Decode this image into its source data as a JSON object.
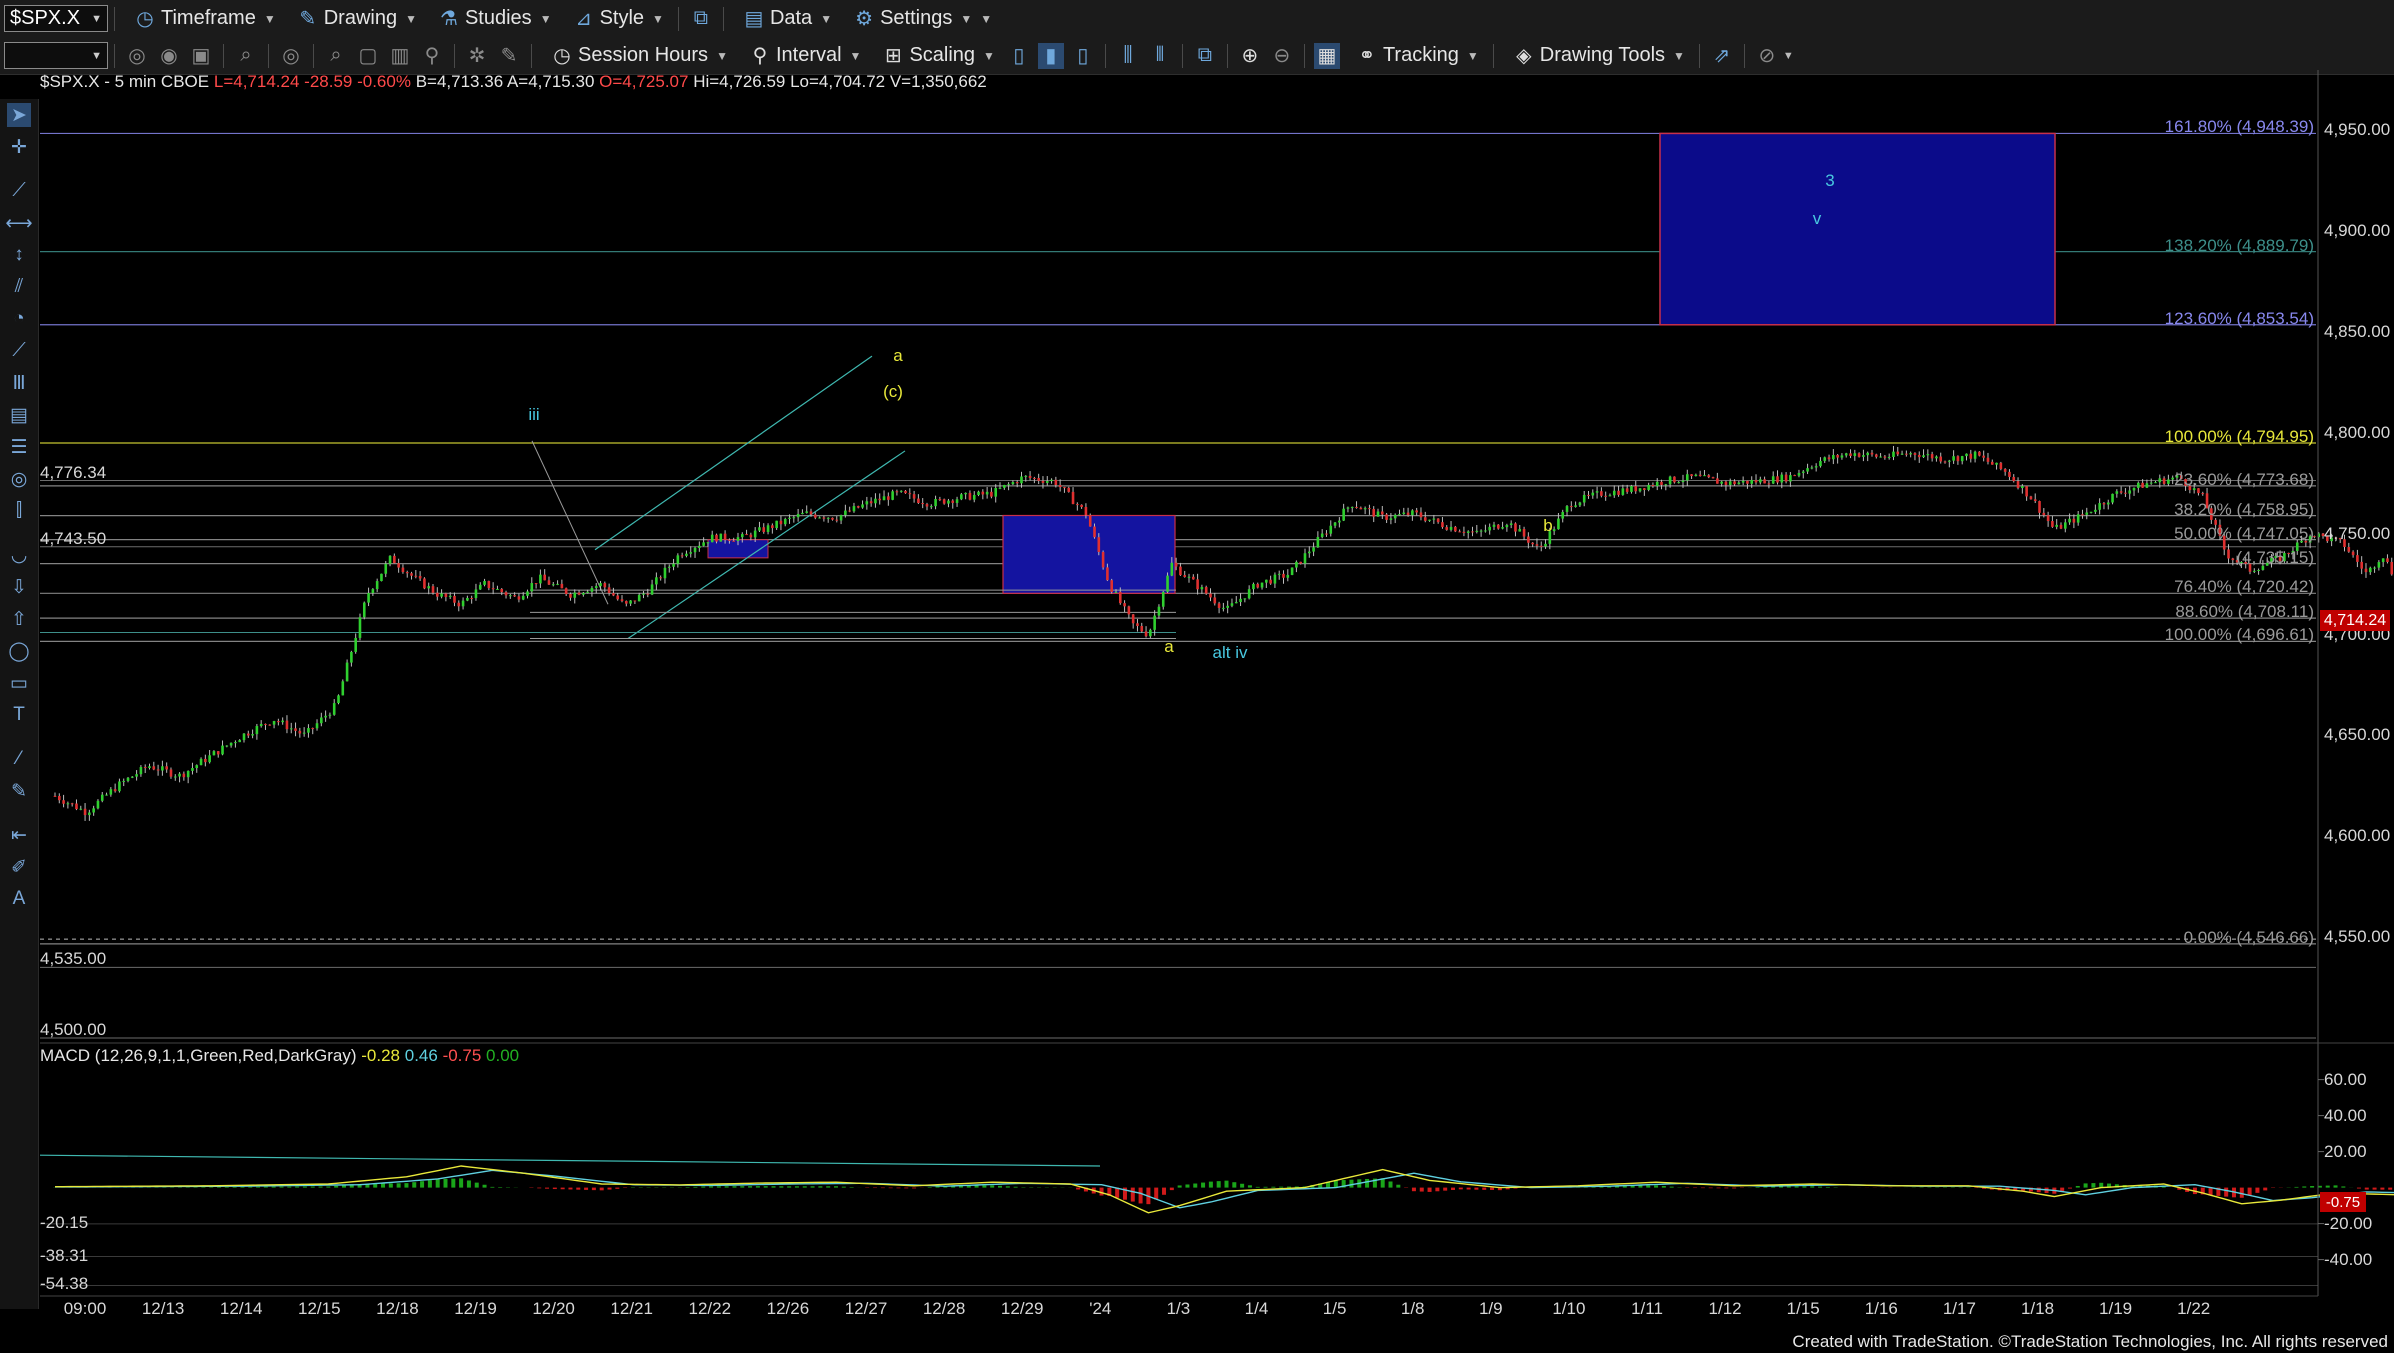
{
  "toolbar1": {
    "symbol": "$SPX.X",
    "items": [
      {
        "label": "Timeframe"
      },
      {
        "label": "Drawing"
      },
      {
        "label": "Studies"
      },
      {
        "label": "Style"
      },
      {
        "label": "Data"
      },
      {
        "label": "Settings"
      }
    ]
  },
  "toolbar2": {
    "items": [
      {
        "label": "Session Hours"
      },
      {
        "label": "Interval"
      },
      {
        "label": "Scaling"
      },
      {
        "label": "Tracking"
      },
      {
        "label": "Drawing Tools"
      }
    ]
  },
  "chart_info": {
    "symbol": "$SPX.X - 5 min  CBOE",
    "last": "L=4,714.24",
    "change": "-28.59",
    "change_pct": "-0.60%",
    "bid": "B=4,713.36",
    "ask": "A=4,715.30",
    "open": "O=4,725.07",
    "high": "Hi=4,726.59",
    "low": "Lo=4,704.72",
    "volume": "V=1,350,662"
  },
  "macd_info": {
    "label": "MACD (12,26,9,1,1,Green,Red,DarkGray)",
    "v1": "-0.28",
    "v2": "0.46",
    "v3": "-0.75",
    "v4": "0.00",
    "c1": "#e8e83a",
    "c2": "#5fd0e0",
    "c3": "#ff5050",
    "c4": "#22b022"
  },
  "chart_data": {
    "type": "candlestick",
    "y_axis_labels": [
      "4,950.00",
      "4,900.00",
      "4,850.00",
      "4,800.00",
      "4,750.00",
      "4,700.00",
      "4,650.00",
      "4,600.00",
      "4,550.00"
    ],
    "ylim": [
      4500,
      4960
    ],
    "macd_axis_labels": [
      "60.00",
      "40.00",
      "20.00",
      "-20.00",
      "-40.00"
    ],
    "macd_ylim": [
      -58,
      72
    ],
    "x_labels": [
      "09:00",
      "12/13",
      "12/14",
      "12/15",
      "12/18",
      "12/19",
      "12/20",
      "12/21",
      "12/22",
      "12/26",
      "12/27",
      "12/28",
      "12/29",
      "'24",
      "1/3",
      "1/4",
      "1/5",
      "1/8",
      "1/9",
      "1/10",
      "1/11",
      "1/12",
      "1/15",
      "1/16",
      "1/17",
      "1/18",
      "1/19",
      "1/22"
    ],
    "last_price_tag": "4,714.24",
    "macd_tag": "-0.75",
    "fib_levels": [
      {
        "label": "161.80% (4,948.39)",
        "value": 4948.39,
        "color": "#8888ee"
      },
      {
        "label": "138.20% (4,889.79)",
        "value": 4889.79,
        "color": "#3d8f8a"
      },
      {
        "label": "123.60% (4,853.54)",
        "value": 4853.54,
        "color": "#8888ee"
      },
      {
        "label": "100.00% (4,794.95)",
        "value": 4794.95,
        "color": "#e8e83a"
      },
      {
        "label": "23.60% (4,773.68)",
        "value": 4773.68,
        "color": "#9a9a9a"
      },
      {
        "label": "38.20% (4,758.95)",
        "value": 4758.95,
        "color": "#9a9a9a"
      },
      {
        "label": "50.00% (4,747.05)",
        "value": 4747.05,
        "color": "#9a9a9a"
      },
      {
        "label": "(4,735.15)",
        "value": 4735.15,
        "color": "#9a9a9a"
      },
      {
        "label": "76.40% (4,720.42)",
        "value": 4720.42,
        "color": "#9a9a9a"
      },
      {
        "label": "88.60% (4,708.11)",
        "value": 4708.11,
        "color": "#9a9a9a"
      },
      {
        "label": "100.00% (4,696.61)",
        "value": 4696.61,
        "color": "#9a9a9a"
      },
      {
        "label": "0.00% (4,546.66)",
        "value": 4546.66,
        "color": "#9a9a9a"
      }
    ],
    "price_levels": [
      {
        "label": "4,776.34",
        "value": 4776.34
      },
      {
        "label": "4,743.50",
        "value": 4743.5
      },
      {
        "label": "4,535.00",
        "value": 4535.0
      },
      {
        "label": "4,500.00",
        "value": 4500.0
      }
    ],
    "macd_levels": [
      {
        "label": "-20.15",
        "value": -20.15
      },
      {
        "label": "-38.31",
        "value": -38.31
      },
      {
        "label": "-54.38",
        "value": -54.38
      }
    ],
    "wave_labels": [
      {
        "text": "iii",
        "color": "#48c8e0"
      },
      {
        "text": "a",
        "color": "#e8e83a"
      },
      {
        "text": "(c)",
        "color": "#e8e83a"
      },
      {
        "text": "b",
        "color": "#e8e83a"
      },
      {
        "text": "a",
        "color": "#e8e83a"
      },
      {
        "text": "alt iv",
        "color": "#48c8e0"
      },
      {
        "text": "3",
        "color": "#48c8e0"
      },
      {
        "text": "v",
        "color": "#48c8e0"
      }
    ],
    "price_path": [
      [
        0.0,
        4620
      ],
      [
        0.4,
        4612
      ],
      [
        0.8,
        4625
      ],
      [
        1.2,
        4635
      ],
      [
        1.6,
        4630
      ],
      [
        2.0,
        4640
      ],
      [
        2.4,
        4650
      ],
      [
        2.8,
        4658
      ],
      [
        3.2,
        4650
      ],
      [
        3.6,
        4665
      ],
      [
        4.0,
        4720
      ],
      [
        4.3,
        4738
      ],
      [
        4.6,
        4728
      ],
      [
        4.9,
        4720
      ],
      [
        5.2,
        4715
      ],
      [
        5.5,
        4725
      ],
      [
        5.9,
        4718
      ],
      [
        6.2,
        4728
      ],
      [
        6.6,
        4720
      ],
      [
        7.0,
        4725
      ],
      [
        7.3,
        4714
      ],
      [
        7.6,
        4722
      ],
      [
        8.0,
        4740
      ],
      [
        8.4,
        4748
      ],
      [
        8.8,
        4748
      ],
      [
        9.2,
        4754
      ],
      [
        9.6,
        4760
      ],
      [
        10.0,
        4758
      ],
      [
        10.4,
        4765
      ],
      [
        10.8,
        4770
      ],
      [
        11.2,
        4765
      ],
      [
        11.6,
        4768
      ],
      [
        12.0,
        4770
      ],
      [
        12.4,
        4778
      ],
      [
        12.8,
        4776
      ],
      [
        13.2,
        4760
      ],
      [
        13.5,
        4725
      ],
      [
        13.8,
        4705
      ],
      [
        14.0,
        4700
      ],
      [
        14.3,
        4735
      ],
      [
        14.6,
        4725
      ],
      [
        15.0,
        4712
      ],
      [
        15.4,
        4725
      ],
      [
        15.8,
        4730
      ],
      [
        16.2,
        4748
      ],
      [
        16.6,
        4765
      ],
      [
        17.0,
        4758
      ],
      [
        17.4,
        4760
      ],
      [
        17.8,
        4754
      ],
      [
        18.2,
        4750
      ],
      [
        18.6,
        4756
      ],
      [
        19.0,
        4742
      ],
      [
        19.4,
        4765
      ],
      [
        19.8,
        4770
      ],
      [
        20.2,
        4772
      ],
      [
        20.6,
        4776
      ],
      [
        21.0,
        4778
      ],
      [
        21.4,
        4775
      ],
      [
        21.8,
        4776
      ],
      [
        22.2,
        4778
      ],
      [
        22.6,
        4786
      ],
      [
        23.0,
        4790
      ],
      [
        23.4,
        4788
      ],
      [
        23.8,
        4790
      ],
      [
        24.2,
        4787
      ],
      [
        24.6,
        4789
      ],
      [
        25.0,
        4780
      ],
      [
        25.3,
        4768
      ],
      [
        25.6,
        4752
      ],
      [
        26.0,
        4760
      ],
      [
        26.4,
        4770
      ],
      [
        26.8,
        4775
      ],
      [
        27.2,
        4778
      ],
      [
        27.5,
        4768
      ],
      [
        27.8,
        4740
      ],
      [
        28.1,
        4732
      ],
      [
        28.5,
        4738
      ],
      [
        28.9,
        4750
      ],
      [
        29.3,
        4745
      ],
      [
        29.6,
        4730
      ],
      [
        29.8,
        4740
      ],
      [
        30.0,
        4725
      ],
      [
        30.3,
        4712
      ],
      [
        30.6,
        4704
      ],
      [
        31.0,
        4710
      ],
      [
        31.3,
        4716
      ],
      [
        31.6,
        4720
      ],
      [
        31.9,
        4714
      ]
    ],
    "macd_path": [
      [
        0,
        0.5
      ],
      [
        2,
        1
      ],
      [
        3.5,
        2
      ],
      [
        4.5,
        6
      ],
      [
        5.2,
        12
      ],
      [
        6,
        8
      ],
      [
        7,
        2
      ],
      [
        8,
        1.5
      ],
      [
        9,
        2.5
      ],
      [
        10,
        3
      ],
      [
        11,
        1
      ],
      [
        12,
        3
      ],
      [
        13,
        2
      ],
      [
        13.5,
        -4
      ],
      [
        14,
        -14
      ],
      [
        14.4,
        -10
      ],
      [
        15,
        -2
      ],
      [
        16,
        0
      ],
      [
        16.6,
        6
      ],
      [
        17,
        10
      ],
      [
        17.6,
        4
      ],
      [
        18.5,
        0
      ],
      [
        19.5,
        1
      ],
      [
        20.5,
        3
      ],
      [
        21.5,
        1
      ],
      [
        22.5,
        2
      ],
      [
        23.5,
        1
      ],
      [
        24.5,
        1
      ],
      [
        25.2,
        -2
      ],
      [
        25.6,
        -5
      ],
      [
        26.2,
        0
      ],
      [
        27,
        2
      ],
      [
        27.5,
        -3
      ],
      [
        28,
        -9
      ],
      [
        28.5,
        -7
      ],
      [
        29.2,
        -3
      ],
      [
        30,
        -4
      ],
      [
        30.6,
        -6
      ],
      [
        31.2,
        -2
      ],
      [
        31.9,
        0
      ]
    ]
  },
  "footer": {
    "text": "Created with TradeStation. ©TradeStation Technologies, Inc. All rights reserved"
  }
}
